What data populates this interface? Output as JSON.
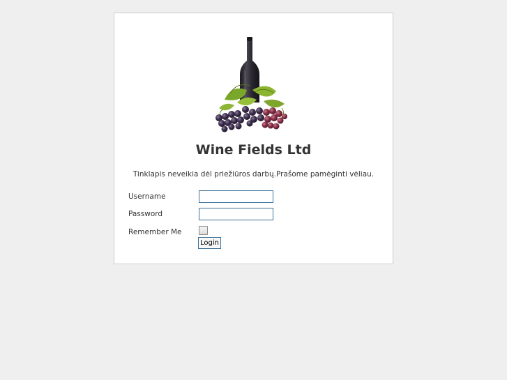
{
  "app": {
    "title": "Wine Fields Ltd",
    "notice": "Tinklapis neveikia dėl priežiūros darbų.Prašome pamėginti vėliau."
  },
  "logo": {
    "icon": "wine-bottle-grapes-icon"
  },
  "form": {
    "username_label": "Username",
    "username_value": "",
    "password_label": "Password",
    "password_value": "",
    "remember_label": "Remember Me",
    "remember_checked": false,
    "login_label": "Login"
  },
  "colors": {
    "background": "#efefef",
    "panel": "#ffffff",
    "field_border": "#3a6f99",
    "text": "#333333"
  }
}
